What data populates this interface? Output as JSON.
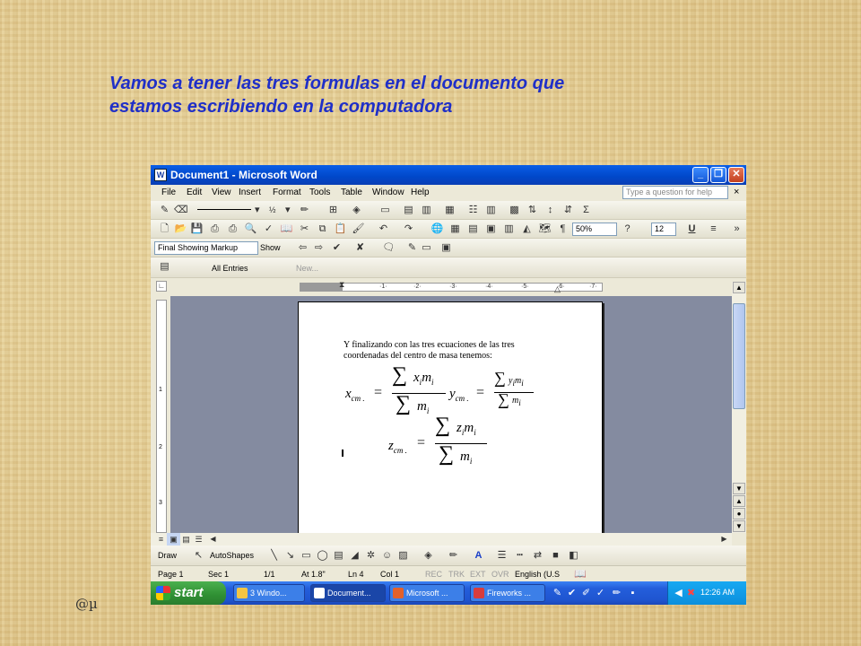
{
  "slide": {
    "title_line1": "Vamos a tener las tres formulas en el documento que",
    "title_line2": "estamos escribiendo en  la computadora",
    "signature": "@µ"
  },
  "window": {
    "title": "Document1 - Microsoft Word",
    "menu": [
      "File",
      "Edit",
      "View",
      "Insert",
      "Format",
      "Tools",
      "Table",
      "Window",
      "Help"
    ],
    "ask_placeholder": "Type a question for help",
    "zoom": "50%",
    "font_size": "12",
    "markup_mode": "Final Showing Markup",
    "show_label": "Show",
    "all_entries": "All Entries",
    "new_label": "New..."
  },
  "document": {
    "text_line1": "Y finalizando con las tres ecuaciones de las tres",
    "text_line2": "coordenadas del centro de masa tenemos:",
    "x_lhs": "x",
    "x_sub": "cm .",
    "x_num": "x",
    "x_num_sub": "i",
    "m": "m",
    "m_sub": "i",
    "y_lhs": "y",
    "y_sub": "cm .",
    "y_num": "y",
    "z_lhs": "z",
    "z_sub": "cm .",
    "z_num": "z",
    "equals": "=",
    "sigma": "∑"
  },
  "drawbar": {
    "draw": "Draw",
    "autoshapes": "AutoShapes"
  },
  "status": {
    "page": "Page  1",
    "sec": "Sec  1",
    "pages": "1/1",
    "at": "At  1.8\"",
    "ln": "Ln  4",
    "col": "Col  1",
    "rec": "REC",
    "trk": "TRK",
    "ext": "EXT",
    "ovr": "OVR",
    "lang": "English (U.S"
  },
  "taskbar": {
    "start": "start",
    "items": [
      "3 Windo...",
      "Document...",
      "Microsoft ...",
      "Fireworks ..."
    ],
    "clock": "12:26 AM"
  },
  "colors": {
    "title_blue": "#1f2fc8",
    "xp_blue": "#0a5ee6",
    "start_green": "#3a9a3d"
  }
}
